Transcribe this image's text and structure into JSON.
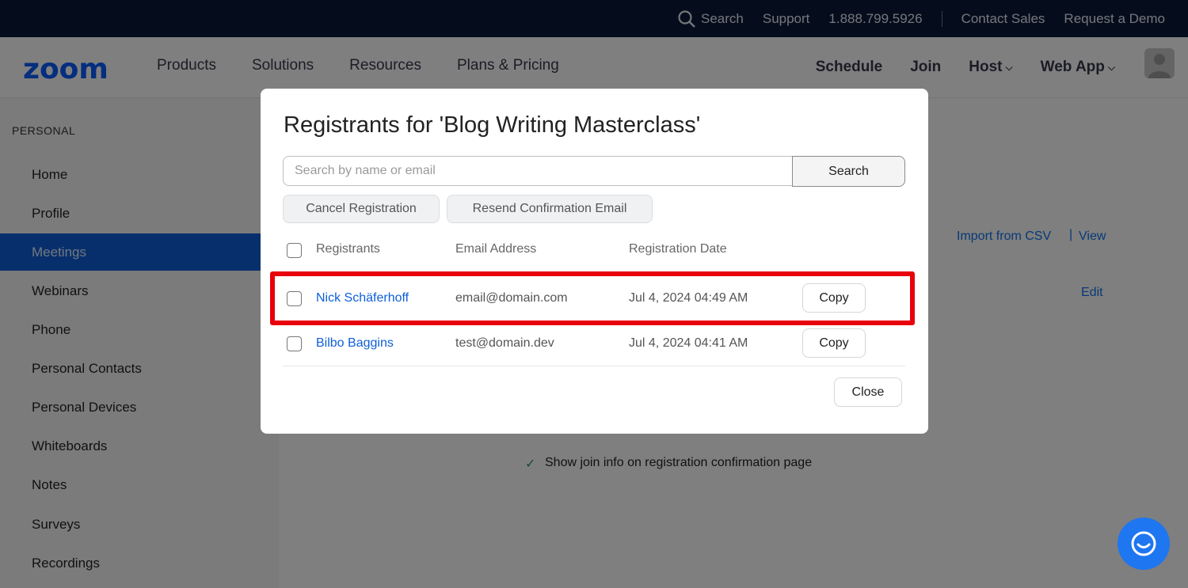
{
  "topbar": {
    "search": "Search",
    "support": "Support",
    "phone": "1.888.799.5926",
    "contact_sales": "Contact Sales",
    "request_demo": "Request a Demo"
  },
  "nav": {
    "logo": "zoom",
    "left": [
      "Products",
      "Solutions",
      "Resources",
      "Plans & Pricing"
    ],
    "schedule": "Schedule",
    "join": "Join",
    "host": "Host",
    "web_app": "Web App"
  },
  "sidebar": {
    "heading": "PERSONAL",
    "items": [
      {
        "label": "Home"
      },
      {
        "label": "Profile"
      },
      {
        "label": "Meetings",
        "active": true
      },
      {
        "label": "Webinars"
      },
      {
        "label": "Phone"
      },
      {
        "label": "Personal Contacts"
      },
      {
        "label": "Personal Devices"
      },
      {
        "label": "Whiteboards"
      },
      {
        "label": "Notes"
      },
      {
        "label": "Surveys"
      },
      {
        "label": "Recordings"
      }
    ]
  },
  "background": {
    "import_csv": "Import from CSV",
    "view": "View",
    "edit": "Edit",
    "join_info": "Show join info on registration confirmation page"
  },
  "modal": {
    "title": "Registrants for 'Blog Writing Masterclass'",
    "search_placeholder": "Search by name or email",
    "search_button": "Search",
    "cancel_registration": "Cancel Registration",
    "resend_email": "Resend Confirmation Email",
    "columns": {
      "registrants": "Registrants",
      "email": "Email Address",
      "date": "Registration Date"
    },
    "rows": [
      {
        "name": "Nick Schäferhoff",
        "email": "email@domain.com",
        "date": "Jul 4, 2024 04:49 AM",
        "action": "Copy"
      },
      {
        "name": "Bilbo Baggins",
        "email": "test@domain.dev",
        "date": "Jul 4, 2024 04:41 AM",
        "action": "Copy"
      }
    ],
    "close": "Close"
  },
  "colors": {
    "brand": "#0b5cff",
    "topbar": "#0b1a3a",
    "active_nav": "#0e5fd8",
    "highlight": "#e8000b"
  }
}
